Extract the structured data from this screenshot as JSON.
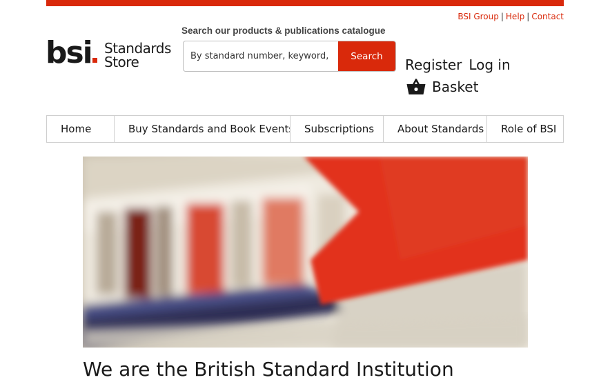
{
  "utility_links": {
    "group": "BSI Group",
    "help": "Help",
    "contact": "Contact",
    "separator": "|"
  },
  "logo": {
    "brand": "bsi",
    "line1": "Standards",
    "line2": "Store"
  },
  "search": {
    "label": "Search our products & publications catalogue",
    "placeholder": "By standard number, keyword, ICS",
    "button_label": "Search"
  },
  "account": {
    "register": "Register",
    "login": "Log in",
    "basket": "Basket"
  },
  "nav": {
    "items": [
      {
        "label": "Home"
      },
      {
        "label": "Buy Standards and Book Events"
      },
      {
        "label": "Subscriptions"
      },
      {
        "label": "About Standards"
      },
      {
        "label": "Role of BSI"
      }
    ]
  },
  "main": {
    "heading": "We are the British Standard Institution"
  },
  "colors": {
    "accent": "#d9290b",
    "text": "#1a1a1a",
    "border": "#cfcfcf"
  }
}
